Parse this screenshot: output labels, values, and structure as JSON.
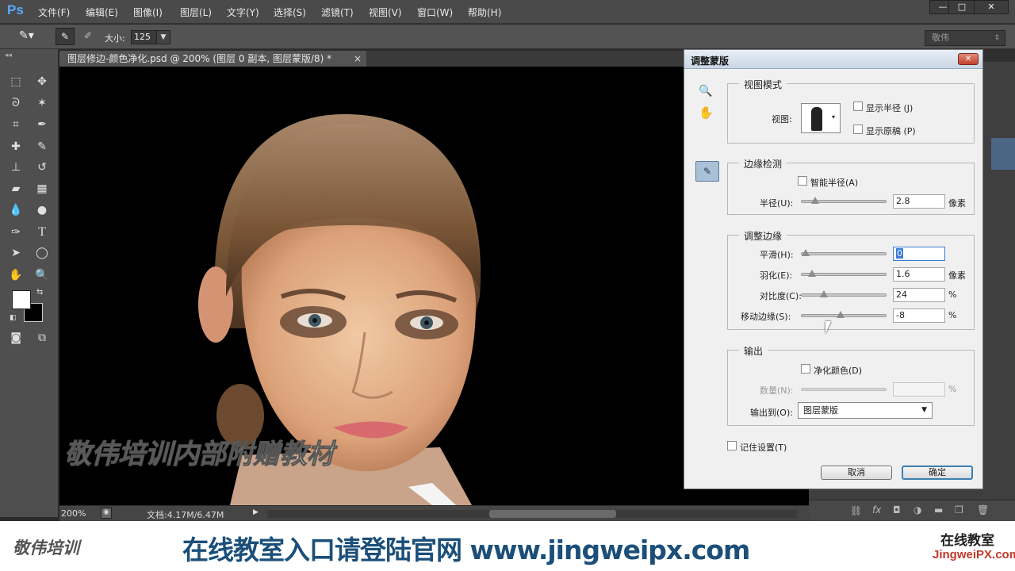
{
  "app": {
    "logo": "Ps"
  },
  "menu": [
    "文件(F)",
    "编辑(E)",
    "图像(I)",
    "图层(L)",
    "文字(Y)",
    "选择(S)",
    "滤镜(T)",
    "视图(V)",
    "窗口(W)",
    "帮助(H)"
  ],
  "window_controls": {
    "minimize": "—",
    "maximize": "□",
    "close": "✕"
  },
  "options_bar": {
    "size_label": "大小:",
    "size_value": "125",
    "workspace": "敬伟"
  },
  "document": {
    "tab_title": "图层修边-颜色净化.psd @ 200% (图层 0 副本, 图层蒙版/8) *",
    "close": "×",
    "zoom": "200%",
    "doc_info": "文档:4.17M/6.47M"
  },
  "watermark": "敬伟培训内部附赠教材",
  "dialog": {
    "title": "调整蒙版",
    "view_mode": {
      "group": "视图模式",
      "view_label": "视图:",
      "show_radius": "显示半径 (J)",
      "show_original": "显示原稿 (P)"
    },
    "edge_detection": {
      "group": "边缘检测",
      "smart_radius": "智能半径(A)",
      "radius_label": "半径(U):",
      "radius_value": "2.8",
      "radius_unit": "像素",
      "radius_pct": 0.13
    },
    "adjust_edge": {
      "group": "调整边缘",
      "smooth_label": "平滑(H):",
      "smooth_value": "0",
      "smooth_pct": 0.0,
      "feather_label": "羽化(E):",
      "feather_value": "1.6",
      "feather_unit": "像素",
      "feather_pct": 0.08,
      "contrast_label": "对比度(C):",
      "contrast_value": "24",
      "contrast_unit": "%",
      "contrast_pct": 0.24,
      "shift_label": "移动边缘(S):",
      "shift_value": "-8",
      "shift_unit": "%",
      "shift_pct": 0.46
    },
    "output": {
      "group": "输出",
      "decontaminate": "净化颜色(D)",
      "amount_label": "数量(N):",
      "amount_unit": "%",
      "output_to_label": "输出到(O):",
      "output_to_value": "图层蒙版"
    },
    "remember": "记住设置(T)",
    "cancel": "取消",
    "ok": "确定"
  },
  "banner": {
    "logo": "敬伟培训",
    "slogan": "在线教室入口请登陆官网 www.jingweipx.com",
    "side_title": "在线教室",
    "side_url": "JingweiPX.com"
  }
}
